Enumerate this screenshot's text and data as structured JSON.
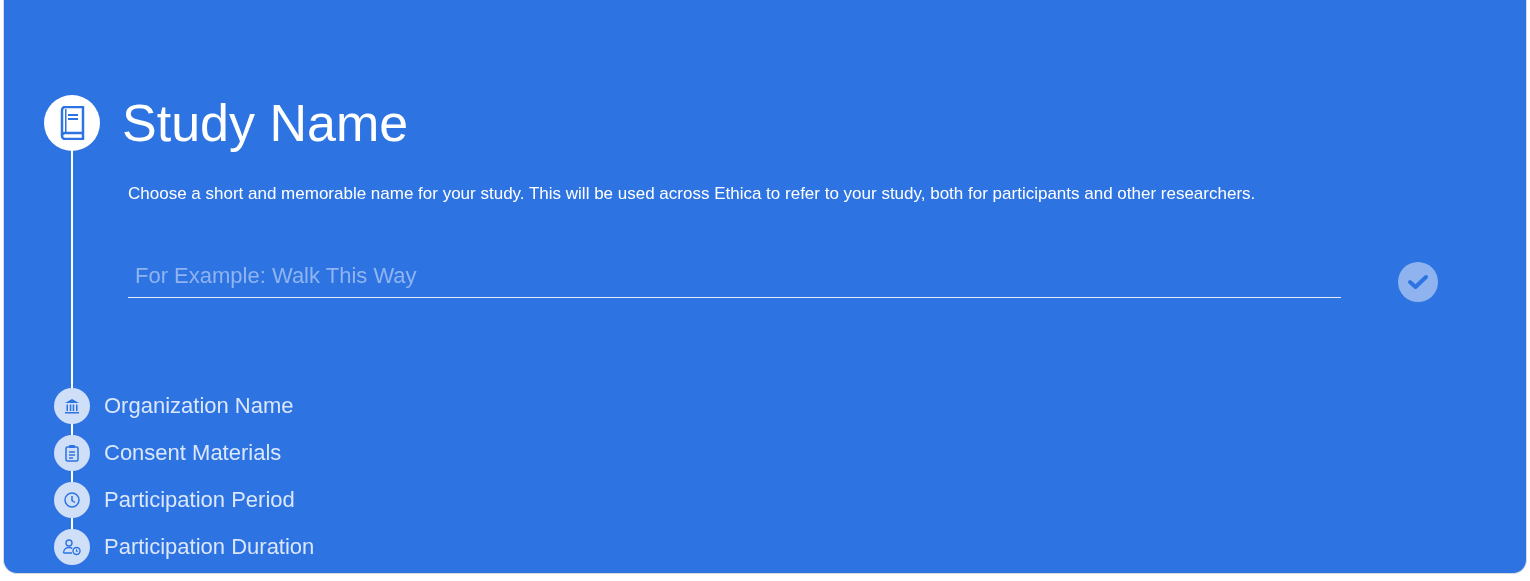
{
  "current_step": {
    "title": "Study Name",
    "description": "Choose a short and memorable name for your study. This will be used across Ethica to refer to your study, both for participants and other researchers.",
    "input": {
      "placeholder": "For Example: Walk This Way"
    },
    "confirm": {
      "disabled": true
    }
  },
  "upcoming_steps": [
    {
      "label": "Organization Name"
    },
    {
      "label": "Consent Materials"
    },
    {
      "label": "Participation Period"
    },
    {
      "label": "Participation Duration"
    }
  ]
}
